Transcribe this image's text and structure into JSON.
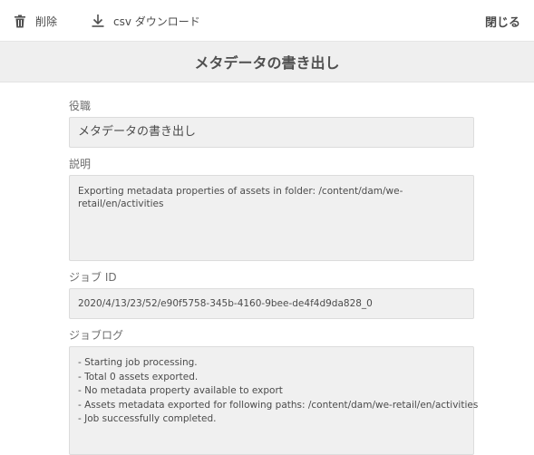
{
  "toolbar": {
    "delete_label": "削除",
    "delete_icon": "trash-icon",
    "csv_label": "csv ダウンロード",
    "csv_icon": "download-icon",
    "close_label": "閉じる"
  },
  "title": "メタデータの書き出し",
  "fields": {
    "title": {
      "label": "役職",
      "value": "メタデータの書き出し"
    },
    "description": {
      "label": "説明",
      "value": "Exporting metadata properties of assets in folder: /content/dam/we-retail/en/activities"
    },
    "job_id": {
      "label": "ジョブ ID",
      "value": "2020/4/13/23/52/e90f5758-345b-4160-9bee-de4f4d9da828_0"
    },
    "job_log": {
      "label": "ジョブログ",
      "lines": [
        "- Starting job processing.",
        "- Total 0 assets exported.",
        "- No metadata property available to export",
        "- Assets metadata exported for following paths: /content/dam/we-retail/en/activities",
        "- Job successfully completed."
      ]
    }
  },
  "colors": {
    "text": "#4b4b4b",
    "title_bar_bg": "#efefef",
    "field_bg": "#f0f0f0",
    "field_border": "#dcdcdc"
  }
}
